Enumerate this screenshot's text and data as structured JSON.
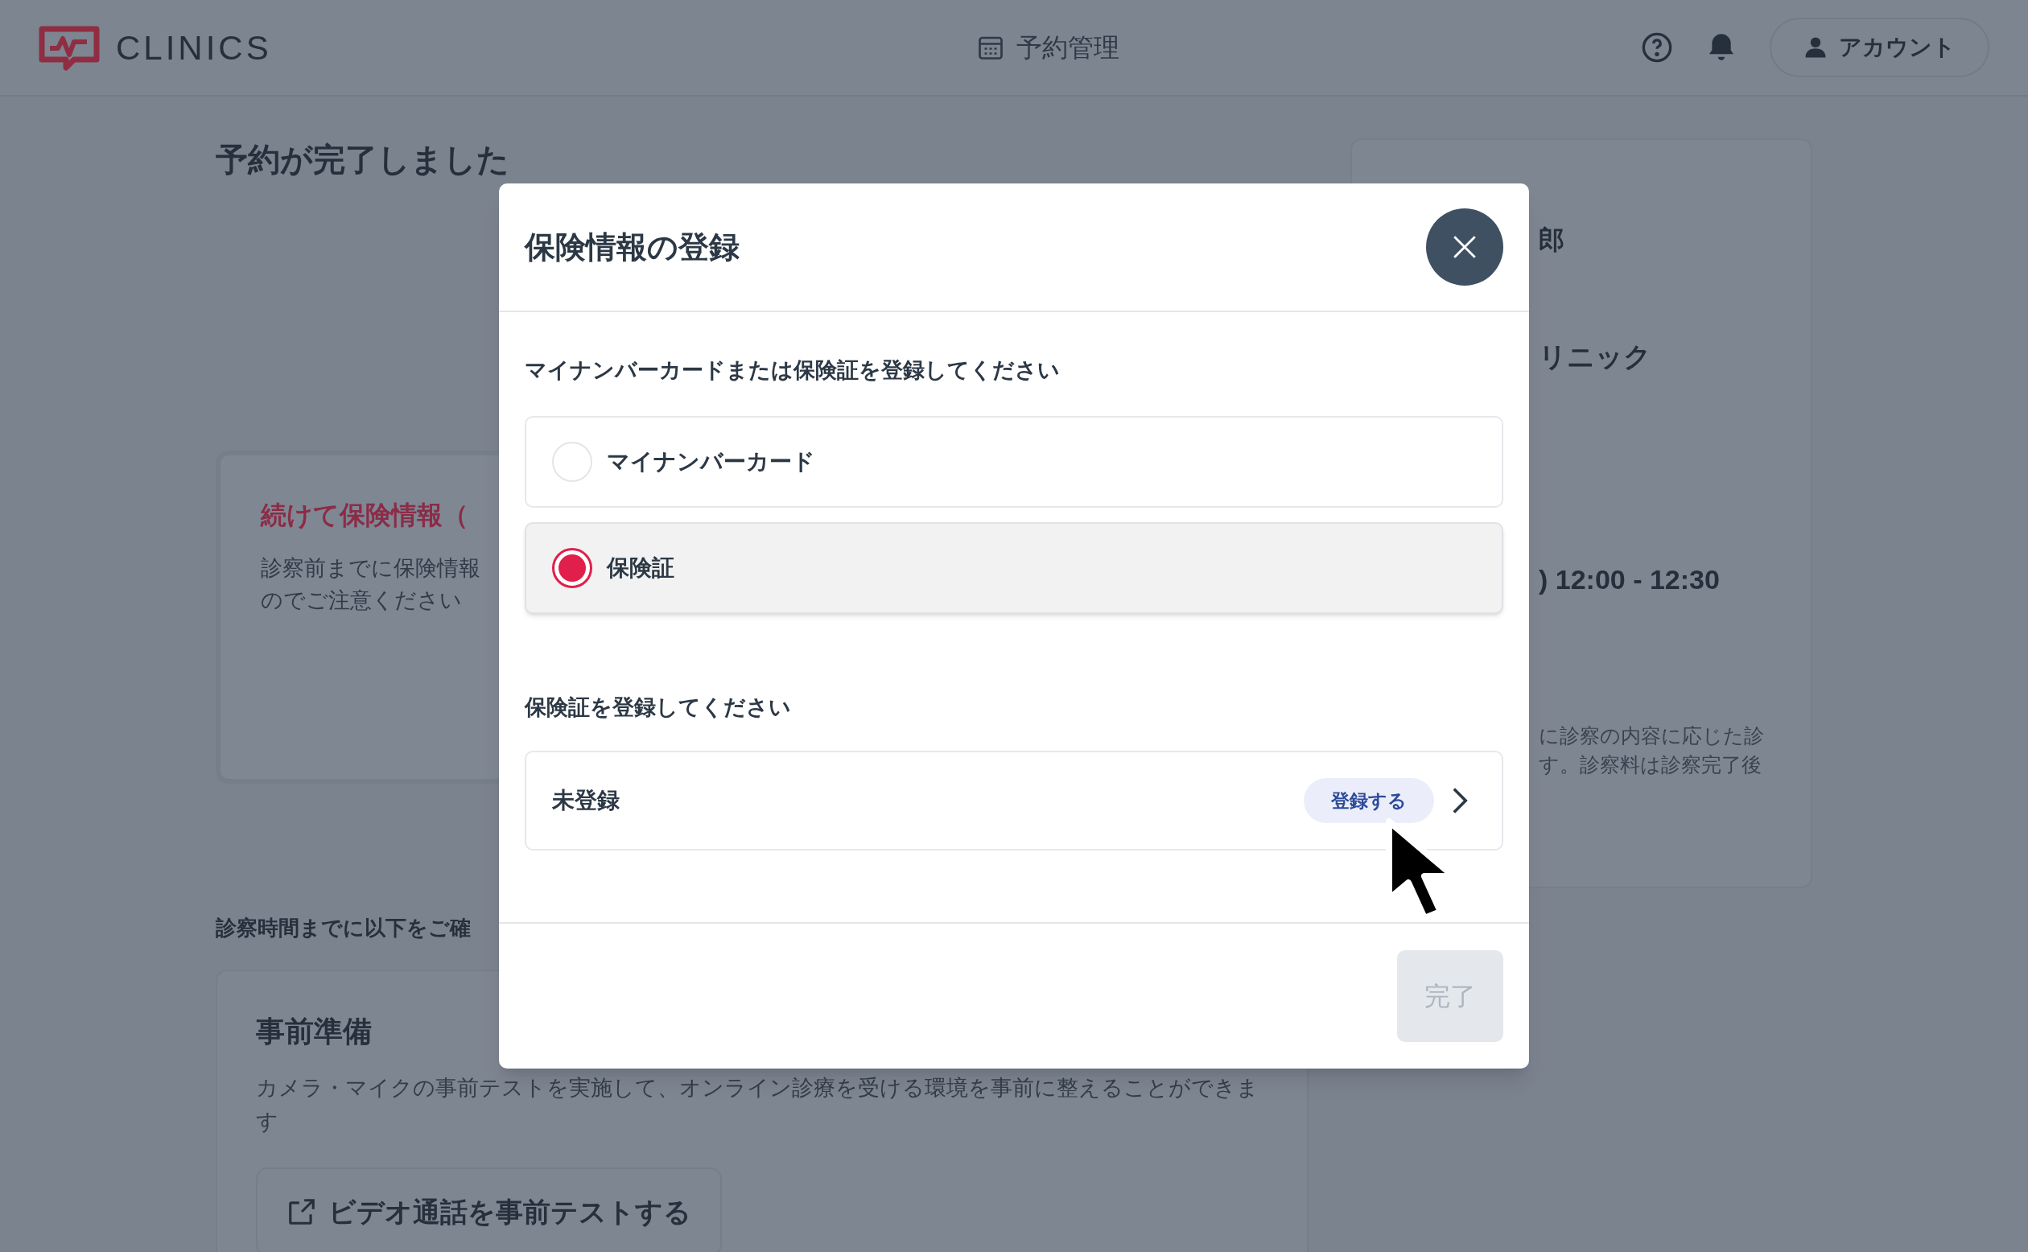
{
  "header": {
    "logo_text": "CLINICS",
    "nav_item": "予約管理",
    "account_button": "アカウント"
  },
  "page": {
    "title": "予約が完了しました",
    "insurance_notice": {
      "title": "続けて保険情報（",
      "body_lines": [
        "診察前までに保険情報",
        "のでご注意ください"
      ]
    },
    "checklist_heading": "診察時間までに以下をご確",
    "prep_card": {
      "title": "事前準備",
      "body": "カメラ・マイクの事前テストを実施して、オンライン診療を受ける環境を事前に整えることができます",
      "button": "ビデオ通話を事前テストする"
    }
  },
  "summary_card": {
    "patient_name": "郎",
    "clinic_name": "リニック",
    "time": ") 12:00 - 12:30",
    "note_lines": [
      "に診察の内容に応じた診",
      "す。診察料は診察完了後"
    ]
  },
  "modal": {
    "title": "保険情報の登録",
    "question": "マイナンバーカードまたは保険証を登録してください",
    "options": [
      {
        "label": "マイナンバーカード",
        "selected": false
      },
      {
        "label": "保険証",
        "selected": true
      }
    ],
    "sub_heading": "保険証を登録してください",
    "registration": {
      "status": "未登録",
      "action": "登録する"
    },
    "done_button": {
      "label": "完了",
      "disabled": true
    }
  }
}
